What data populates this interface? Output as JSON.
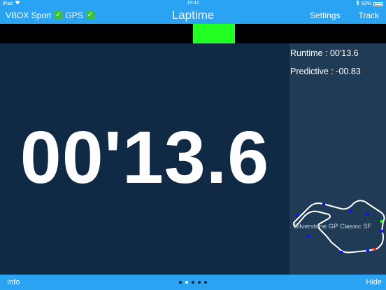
{
  "status": {
    "device": "iPad",
    "time": "15:41",
    "battery": "93%"
  },
  "nav": {
    "title": "Laptime",
    "left_vbox": "VBOX Sport",
    "left_gps": "GPS",
    "check_symbol": "✓",
    "settings_label": "Settings",
    "track_label": "Track"
  },
  "delta": {
    "indicator_color": "#22ff22",
    "bar_color": "#000000"
  },
  "main": {
    "laptime": "00'13.6"
  },
  "stats": {
    "runtime": "Runtime : 00'13.6",
    "predictive": "Predictive : -00.83"
  },
  "track": {
    "name": "Silverstone GP Classic SF"
  },
  "bottom": {
    "info_label": "Info",
    "hide_label": "Hide",
    "pages": 5,
    "active_page": 1
  },
  "colors": {
    "accent": "#2aa4f2",
    "main_bg": "#102a45",
    "side_bg": "#203b55",
    "track_marker_blue": "#1010ff",
    "track_marker_red": "#ff2020",
    "track_marker_green": "#20ff20"
  }
}
